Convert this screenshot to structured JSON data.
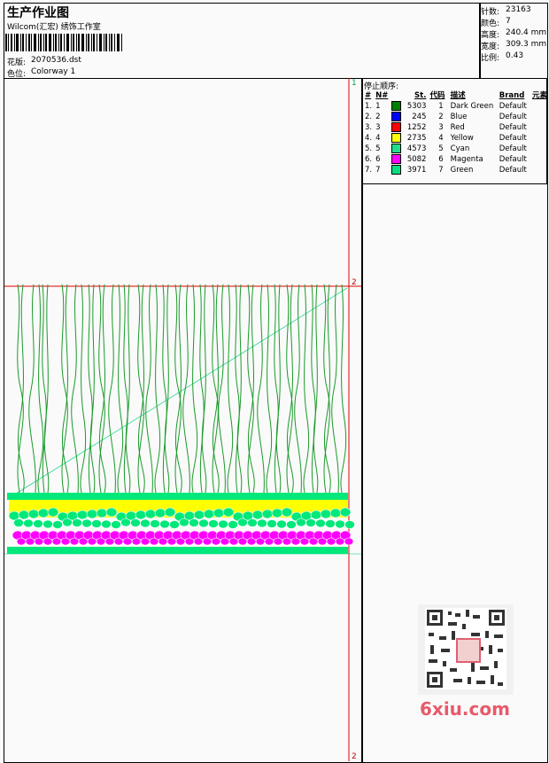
{
  "header": {
    "title": "生产作业图",
    "company": "Wilcom(汇宏) 绣饰工作室",
    "design_label": "花版:",
    "design_value": "2070536.dst",
    "colorway_label": "色位:",
    "colorway_value": "Colorway 1"
  },
  "stats": {
    "stitches_label": "针数:",
    "stitches_value": "23163",
    "colors_label": "颜色:",
    "colors_value": "7",
    "height_label": "高度:",
    "height_value": "240.4 mm",
    "width_label": "宽度:",
    "width_value": "309.3 mm",
    "scale_label": "比例:",
    "scale_value": "0.43"
  },
  "stop_sequence": {
    "label": "停止顺序:",
    "headers": {
      "num": "#",
      "n": "N#",
      "st": "St.",
      "code": "代码",
      "desc": "描述",
      "brand": "Brand",
      "element": "元素"
    },
    "rows": [
      {
        "num": "1.",
        "n": "1",
        "color": "#008000",
        "st": "5303",
        "code": "1",
        "desc": "Dark Green",
        "brand": "Default"
      },
      {
        "num": "2.",
        "n": "2",
        "color": "#0000ff",
        "st": "245",
        "code": "2",
        "desc": "Blue",
        "brand": "Default"
      },
      {
        "num": "3.",
        "n": "3",
        "color": "#ff0000",
        "st": "1252",
        "code": "3",
        "desc": "Red",
        "brand": "Default"
      },
      {
        "num": "4.",
        "n": "4",
        "color": "#ffff00",
        "st": "2735",
        "code": "4",
        "desc": "Yellow",
        "brand": "Default"
      },
      {
        "num": "5.",
        "n": "5",
        "color": "#22dd88",
        "st": "4573",
        "code": "5",
        "desc": "Cyan",
        "brand": "Default"
      },
      {
        "num": "6.",
        "n": "6",
        "color": "#ff00ff",
        "st": "5082",
        "code": "6",
        "desc": "Magenta",
        "brand": "Default"
      },
      {
        "num": "7.",
        "n": "7",
        "color": "#00e080",
        "st": "3971",
        "code": "7",
        "desc": "Green",
        "brand": "Default"
      }
    ]
  },
  "markers": {
    "m1": "1",
    "m2": "2",
    "m3": "2"
  },
  "colors": {
    "grass": "#1a9a2a",
    "band": "#00e87a",
    "yellow": "#ffff00",
    "magenta": "#ff00ff",
    "guide": "#e00000",
    "diag": "#20d890"
  },
  "watermark": {
    "text": "6xiu.com"
  }
}
